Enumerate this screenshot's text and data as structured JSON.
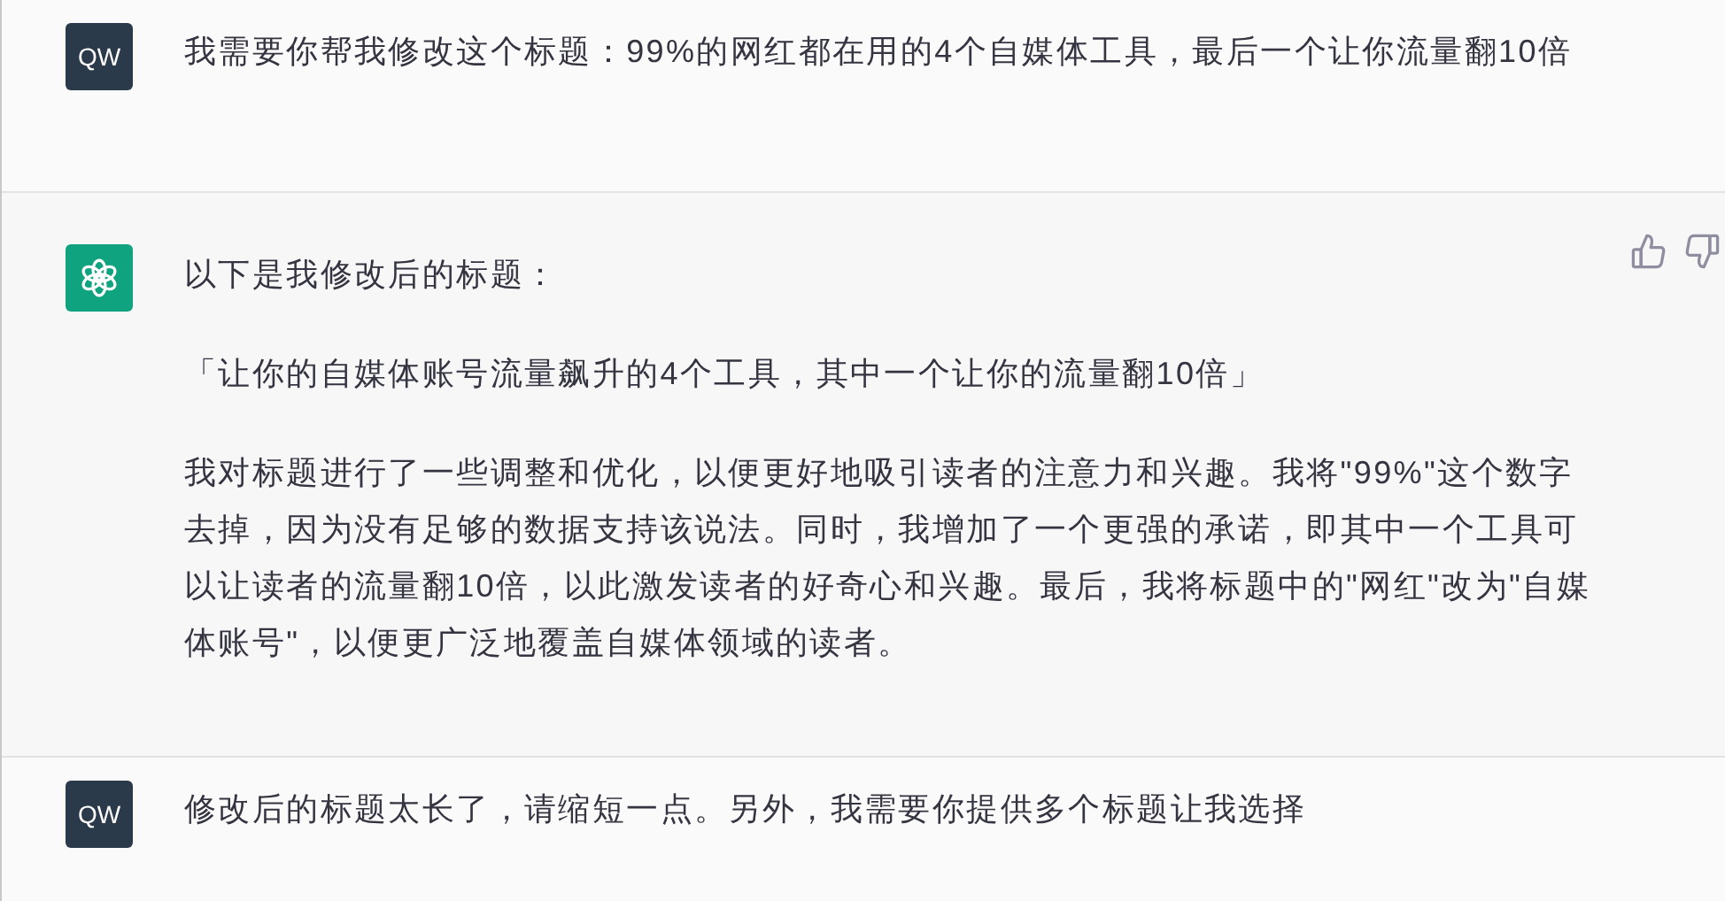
{
  "messages": [
    {
      "kind": "user",
      "avatar": "QW",
      "paragraphs": [
        "我需要你帮我修改这个标题：99%的网红都在用的4个自媒体工具，最后一个让你流量翻10倍"
      ]
    },
    {
      "kind": "assistant",
      "paragraphs": [
        "以下是我修改后的标题：",
        "「让你的自媒体账号流量飙升的4个工具，其中一个让你的流量翻10倍」",
        "我对标题进行了一些调整和优化，以便更好地吸引读者的注意力和兴趣。我将\"99%\"这个数字去掉，因为没有足够的数据支持该说法。同时，我增加了一个更强的承诺，即其中一个工具可以让读者的流量翻10倍，以此激发读者的好奇心和兴趣。最后，我将标题中的\"网红\"改为\"自媒体账号\"，以便更广泛地覆盖自媒体领域的读者。"
      ]
    },
    {
      "kind": "user",
      "avatar": "QW",
      "paragraphs": [
        "修改后的标题太长了，请缩短一点。另外，我需要你提供多个标题让我选择"
      ]
    }
  ]
}
